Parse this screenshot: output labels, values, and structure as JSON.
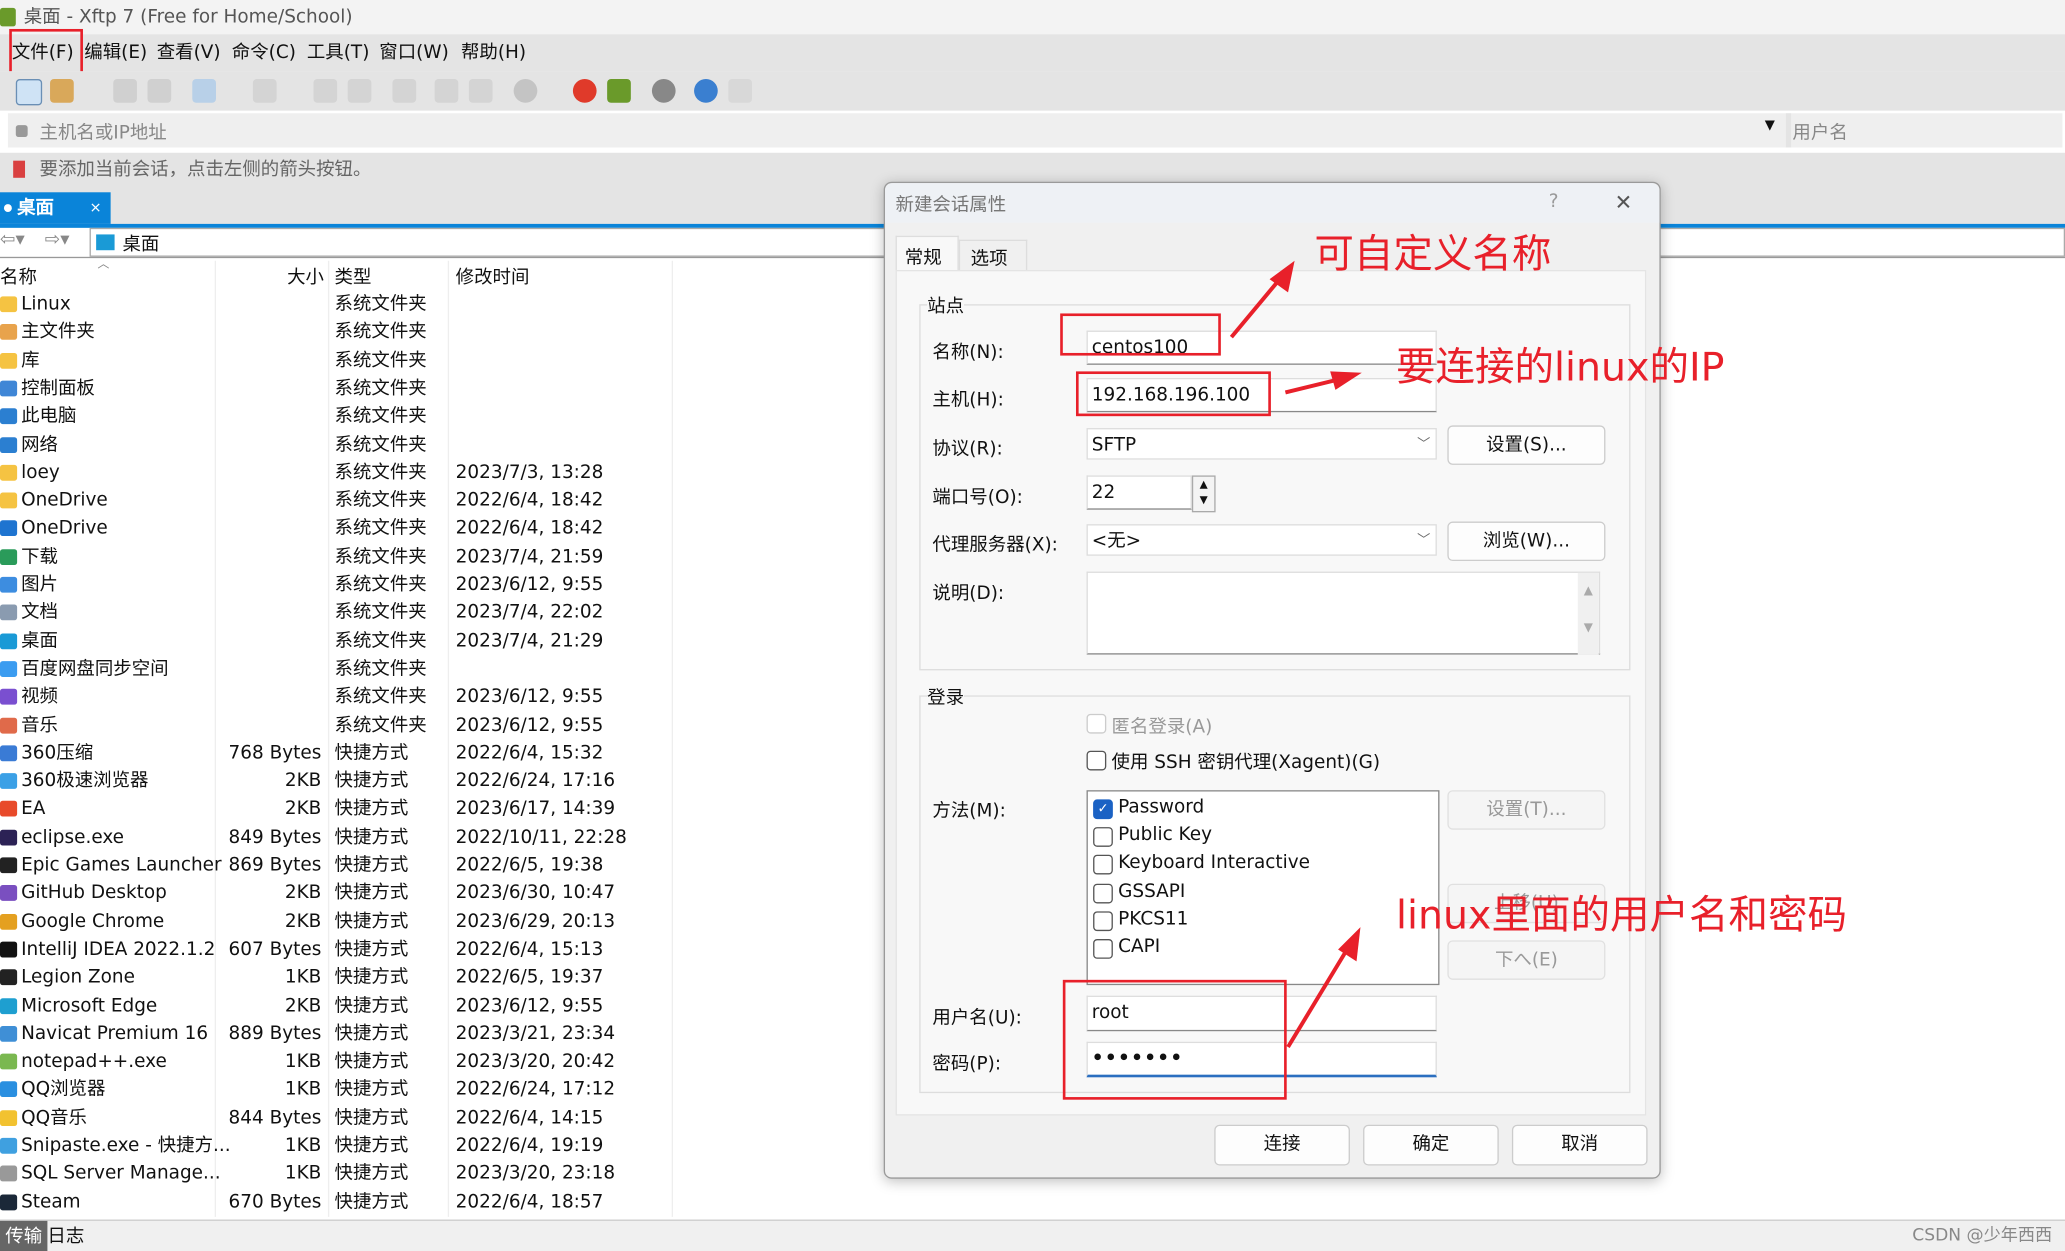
{
  "window": {
    "title": "桌面 - Xftp 7 (Free for Home/School)"
  },
  "menu": [
    "文件(F)",
    "编辑(E)",
    "查看(V)",
    "命令(C)",
    "工具(T)",
    "窗口(W)",
    "帮助(H)"
  ],
  "address": {
    "host_placeholder": "主机名或IP地址",
    "user_placeholder": "用户名"
  },
  "hint": "要添加当前会话，点击左侧的箭头按钮。",
  "tab": {
    "label": "桌面",
    "close": "×"
  },
  "path": "桌面",
  "columns": [
    "名称",
    "大小",
    "类型",
    "修改时间"
  ],
  "files": [
    {
      "name": "Linux",
      "size": "",
      "type": "系统文件夹",
      "time": "",
      "color": "#f5c342"
    },
    {
      "name": "主文件夹",
      "size": "",
      "type": "系统文件夹",
      "time": "",
      "color": "#e8a34c"
    },
    {
      "name": "库",
      "size": "",
      "type": "系统文件夹",
      "time": "",
      "color": "#f5c342"
    },
    {
      "name": "控制面板",
      "size": "",
      "type": "系统文件夹",
      "time": "",
      "color": "#3f86d6"
    },
    {
      "name": "此电脑",
      "size": "",
      "type": "系统文件夹",
      "time": "",
      "color": "#2b7fd1"
    },
    {
      "name": "网络",
      "size": "",
      "type": "系统文件夹",
      "time": "",
      "color": "#2b7fd1"
    },
    {
      "name": "loey",
      "size": "",
      "type": "系统文件夹",
      "time": "2023/7/3, 13:28",
      "color": "#f5c342"
    },
    {
      "name": "OneDrive",
      "size": "",
      "type": "系统文件夹",
      "time": "2022/6/4, 18:42",
      "color": "#f5c342"
    },
    {
      "name": "OneDrive",
      "size": "",
      "type": "系统文件夹",
      "time": "2022/6/4, 18:42",
      "color": "#1e74d0"
    },
    {
      "name": "下载",
      "size": "",
      "type": "系统文件夹",
      "time": "2023/7/4, 21:59",
      "color": "#2a9b5a"
    },
    {
      "name": "图片",
      "size": "",
      "type": "系统文件夹",
      "time": "2023/6/12, 9:55",
      "color": "#3d8de0"
    },
    {
      "name": "文档",
      "size": "",
      "type": "系统文件夹",
      "time": "2023/7/4, 22:02",
      "color": "#8a9bb0"
    },
    {
      "name": "桌面",
      "size": "",
      "type": "系统文件夹",
      "time": "2023/7/4, 21:29",
      "color": "#1a9ad6"
    },
    {
      "name": "百度网盘同步空间",
      "size": "",
      "type": "系统文件夹",
      "time": "",
      "color": "#3b9cf0"
    },
    {
      "name": "视频",
      "size": "",
      "type": "系统文件夹",
      "time": "2023/6/12, 9:55",
      "color": "#7a4fd0"
    },
    {
      "name": "音乐",
      "size": "",
      "type": "系统文件夹",
      "time": "2023/6/12, 9:55",
      "color": "#e06a4a"
    },
    {
      "name": "360压缩",
      "size": "768 Bytes",
      "type": "快捷方式",
      "time": "2022/6/4, 15:32",
      "color": "#3a7bd5"
    },
    {
      "name": "360极速浏览器",
      "size": "2KB",
      "type": "快捷方式",
      "time": "2022/6/24, 17:16",
      "color": "#3ba0e6"
    },
    {
      "name": "EA",
      "size": "2KB",
      "type": "快捷方式",
      "time": "2023/6/17, 14:39",
      "color": "#e84a2a"
    },
    {
      "name": "eclipse.exe",
      "size": "849 Bytes",
      "type": "快捷方式",
      "time": "2022/10/11, 22:28",
      "color": "#2c2255"
    },
    {
      "name": "Epic Games Launcher",
      "size": "869 Bytes",
      "type": "快捷方式",
      "time": "2022/6/5, 19:38",
      "color": "#222222"
    },
    {
      "name": "GitHub Desktop",
      "size": "2KB",
      "type": "快捷方式",
      "time": "2023/6/30, 10:47",
      "color": "#7a4fc0"
    },
    {
      "name": "Google Chrome",
      "size": "2KB",
      "type": "快捷方式",
      "time": "2023/6/29, 20:13",
      "color": "#e4a020"
    },
    {
      "name": "IntelliJ IDEA 2022.1.2",
      "size": "607 Bytes",
      "type": "快捷方式",
      "time": "2022/6/4, 15:13",
      "color": "#111111"
    },
    {
      "name": "Legion Zone",
      "size": "1KB",
      "type": "快捷方式",
      "time": "2022/6/5, 19:37",
      "color": "#222222"
    },
    {
      "name": "Microsoft Edge",
      "size": "2KB",
      "type": "快捷方式",
      "time": "2023/6/12, 9:55",
      "color": "#1e9fd0"
    },
    {
      "name": "Navicat Premium 16",
      "size": "889 Bytes",
      "type": "快捷方式",
      "time": "2023/3/21, 23:34",
      "color": "#3f8fd6"
    },
    {
      "name": "notepad++.exe",
      "size": "1KB",
      "type": "快捷方式",
      "time": "2023/3/20, 20:42",
      "color": "#7ab850"
    },
    {
      "name": "QQ浏览器",
      "size": "1KB",
      "type": "快捷方式",
      "time": "2022/6/24, 17:12",
      "color": "#2a8fe0"
    },
    {
      "name": "QQ音乐",
      "size": "844 Bytes",
      "type": "快捷方式",
      "time": "2022/6/4, 14:15",
      "color": "#f2c230"
    },
    {
      "name": "Snipaste.exe - 快捷方...",
      "size": "1KB",
      "type": "快捷方式",
      "time": "2022/6/4, 19:19",
      "color": "#3fa0e0"
    },
    {
      "name": "SQL Server Manage...",
      "size": "1KB",
      "type": "快捷方式",
      "time": "2023/3/20, 23:18",
      "color": "#999999"
    },
    {
      "name": "Steam",
      "size": "670 Bytes",
      "type": "快捷方式",
      "time": "2022/6/4, 18:57",
      "color": "#1b2838"
    }
  ],
  "status": {
    "tabs": [
      "传输",
      "日志"
    ],
    "watermark": "CSDN @少年西西"
  },
  "dialog": {
    "title": "新建会话属性",
    "help": "?",
    "close": "✕",
    "tabs": [
      "常规",
      "选项"
    ],
    "site_group": "站点",
    "name_label": "名称(N):",
    "name_value": "centos100",
    "host_label": "主机(H):",
    "host_value": "192.168.196.100",
    "protocol_label": "协议(R):",
    "protocol_value": "SFTP",
    "protocol_settings": "设置(S)...",
    "port_label": "端口号(O):",
    "port_value": "22",
    "proxy_label": "代理服务器(X):",
    "proxy_value": "<无>",
    "proxy_browse": "浏览(W)...",
    "desc_label": "说明(D):",
    "login_group": "登录",
    "anonymous": "匿名登录(A)",
    "agent": "使用 SSH 密钥代理(Xagent)(G)",
    "method_label": "方法(M):",
    "methods": [
      {
        "label": "Password",
        "checked": true
      },
      {
        "label": "Public Key",
        "checked": false
      },
      {
        "label": "Keyboard Interactive",
        "checked": false
      },
      {
        "label": "GSSAPI",
        "checked": false
      },
      {
        "label": "PKCS11",
        "checked": false
      },
      {
        "label": "CAPI",
        "checked": false
      }
    ],
    "method_settings": "设置(T)...",
    "move_up": "上移(U)",
    "move_down": "下へ(E)",
    "user_label": "用户名(U):",
    "user_value": "root",
    "pass_label": "密码(P):",
    "pass_value": "•••••••",
    "connect": "连接",
    "ok": "确定",
    "cancel": "取消"
  },
  "annotations": {
    "name": "可自定义名称",
    "ip": "要连接的linux的IP",
    "cred": "linux里面的用户名和密码"
  },
  "colors": {
    "accent": "#0a84d9",
    "annotation": "#e8202a"
  }
}
